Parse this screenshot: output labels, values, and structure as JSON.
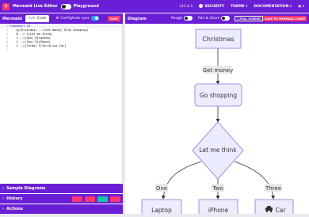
{
  "topbar": {
    "title": "Mermaid Live Editor",
    "playground_label": "Playground",
    "version": "v11.4.1",
    "security": "SECURITY",
    "theme": "THEME",
    "documentation": "DOCUMENTATION"
  },
  "editor": {
    "panel_title": "Mermaid",
    "tab_code": "Code",
    "tab_config": "Config",
    "autosync_label": "Auto sync",
    "save_label": "SAVE",
    "lines": [
      {
        "num": "1",
        "text": "flowchart TD"
      },
      {
        "num": "2",
        "text": "    A[Christmas] -->|Get money| B(Go shopping)"
      },
      {
        "num": "3",
        "text": "    B --> C{Let me think}"
      },
      {
        "num": "4",
        "text": "    C -->|One| D[Laptop]"
      },
      {
        "num": "5",
        "text": "    C -->|Two| E[iPhone]"
      },
      {
        "num": "6",
        "text": "    C -->|Three| F[fa:fa-car Car]"
      },
      {
        "num": "7",
        "text": ""
      }
    ]
  },
  "sections": {
    "sample_diagrams": "Sample Diagrams",
    "history": "History",
    "actions": "Actions"
  },
  "diagram_panel": {
    "title": "Diagram",
    "rough_label": "Rough",
    "pan_zoom_label": "Pan & Zoom",
    "fullscreen_label": "FULL SCREEN",
    "save_label": "SAVE TO MERMAID CHART"
  },
  "flowchart": {
    "node_a": "Christmas",
    "edge_ab": "Get money",
    "node_b": "Go shopping",
    "node_c": "Let me think",
    "edge_cd": "One",
    "edge_ce": "Two",
    "edge_cf": "Three",
    "node_d": "Laptop",
    "node_e": "iPhone",
    "node_f": "Car"
  },
  "colors": {
    "brand": "#6a1fd6",
    "accent": "#ff3670",
    "node_fill": "#ececff",
    "node_stroke": "#9370db"
  }
}
